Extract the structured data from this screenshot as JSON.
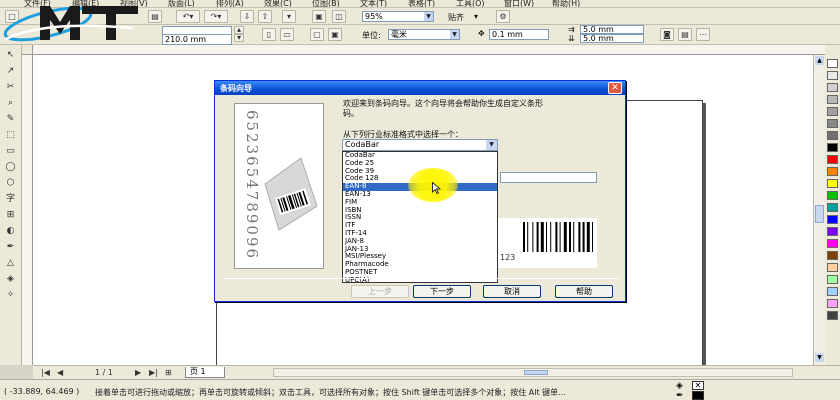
{
  "menu": [
    "文件(F)",
    "编辑(E)",
    "视图(V)",
    "版面(L)",
    "排列(A)",
    "效果(C)",
    "位图(B)",
    "文本(T)",
    "表格(T)",
    "工具(O)",
    "窗口(W)",
    "帮助(H)"
  ],
  "toolbar1": {
    "zoom_value": "95%",
    "snap_label": "贴齐"
  },
  "toolbar2": {
    "width_value": "210.0 mm",
    "unit_label": "单位:",
    "unit_value": "毫米",
    "nudge_value": "0.1 mm",
    "dup_x": "5.0 mm",
    "dup_y": "5.0 mm"
  },
  "page_nav": {
    "page_counter": "1 / 1",
    "page_tab": "页 1"
  },
  "status": {
    "coords": "( -33.889, 64.469 )",
    "hint": "接着单击可进行拖动或缩放；再单击可旋转或倾斜；双击工具，可选择所有对象；按住 Shift 键单击可选择多个对象；按住 Alt 键单..."
  },
  "dialog": {
    "title": "条码向导",
    "art_digits": "6523654789096",
    "welcome": "欢迎来到条码向导。这个向导将会帮助你生成自定义条形码。",
    "prompt": "从下列行业标准格式中选择一个：",
    "selected_format": "CodaBar",
    "formats": [
      "CodaBar",
      "Code 25",
      "Code 39",
      "Code 128",
      "EAN-8",
      "EAN-13",
      "FIM",
      "ISBN",
      "ISSN",
      "ITF",
      "ITF-14",
      "JAN-8",
      "JAN-13",
      "MSI/Plessey",
      "Pharmacode",
      "POSTNET",
      "UPC(A)",
      "UPC(E)"
    ],
    "highlighted_format": "EAN-8",
    "preview_number": "123",
    "buttons": {
      "back": "上一步",
      "next": "下一步",
      "cancel": "取消",
      "help": "帮助"
    }
  },
  "colors": {
    "title_blue": "#0a50d8",
    "highlight_blue": "#316ac5",
    "palette": [
      "#ffffff",
      "#e8e8e8",
      "#d0d0d0",
      "#b8b8b8",
      "#a0a0a0",
      "#888888",
      "#707070",
      "#000000",
      "#ff0000",
      "#ff8000",
      "#ffff00",
      "#00c000",
      "#00a0a0",
      "#0000ff",
      "#8000ff",
      "#ff00ff",
      "#804000",
      "#ffd0a0",
      "#a0ffa0",
      "#a0d0ff",
      "#ffa0ff",
      "#404040"
    ]
  }
}
